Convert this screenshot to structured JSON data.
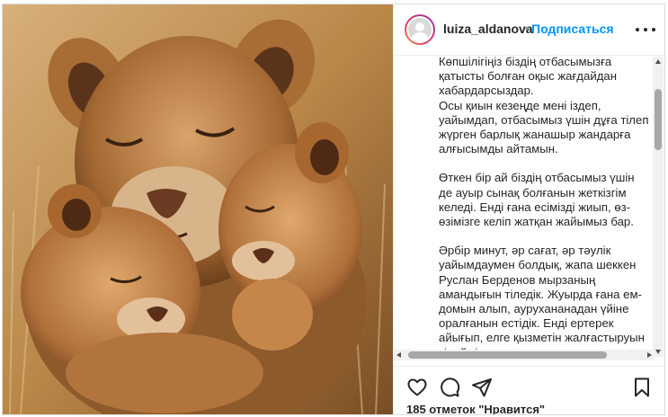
{
  "post": {
    "username": "luiza_aldanova",
    "separator": "•",
    "follow_label": "Подписаться",
    "more_icon": "more-horizontal-icon",
    "photo_description_icon": "lioness-with-cubs-photo",
    "caption": [
      "Көпшілігіңіз біздің отбасымызға\nқатысты болған оқыс жағдайдан\nхабардарсыздар.\nОсы қиын кезеңде мені іздеп,\nуайымдап, отбасымыз үшін дұға тілеп\nжүрген барлық жанашыр жандарға\nалғысымды айтамын.",
      "Өткен бір ай біздің отбасымыз үшін\nде ауыр сынақ болғанын жеткізгім\nкеледі. Енді ғана есімізді жиып, өз-\nөзімізге келіп жатқан жайымыз бар.",
      "Әрбір минут, әр сағат, әр тәулік\nуайымдаумен болдық, жапа шеккен\nРуслан Берденов мырзаның\nамандығын тіледік. Жуырда ғана ем-\nдомын алып, аурухананадан үйіне\nоралғанын естідік. Енді ертерек\nайығып, елге қызметін жалғастыруын\nтілейміз."
    ],
    "likes_text": "185 отметок \"Нравится\""
  },
  "icons": {
    "like": "heart-icon",
    "comment": "comment-icon",
    "share": "share-icon",
    "save": "bookmark-icon"
  },
  "colors": {
    "accent": "#0095f6",
    "text": "#262626"
  }
}
